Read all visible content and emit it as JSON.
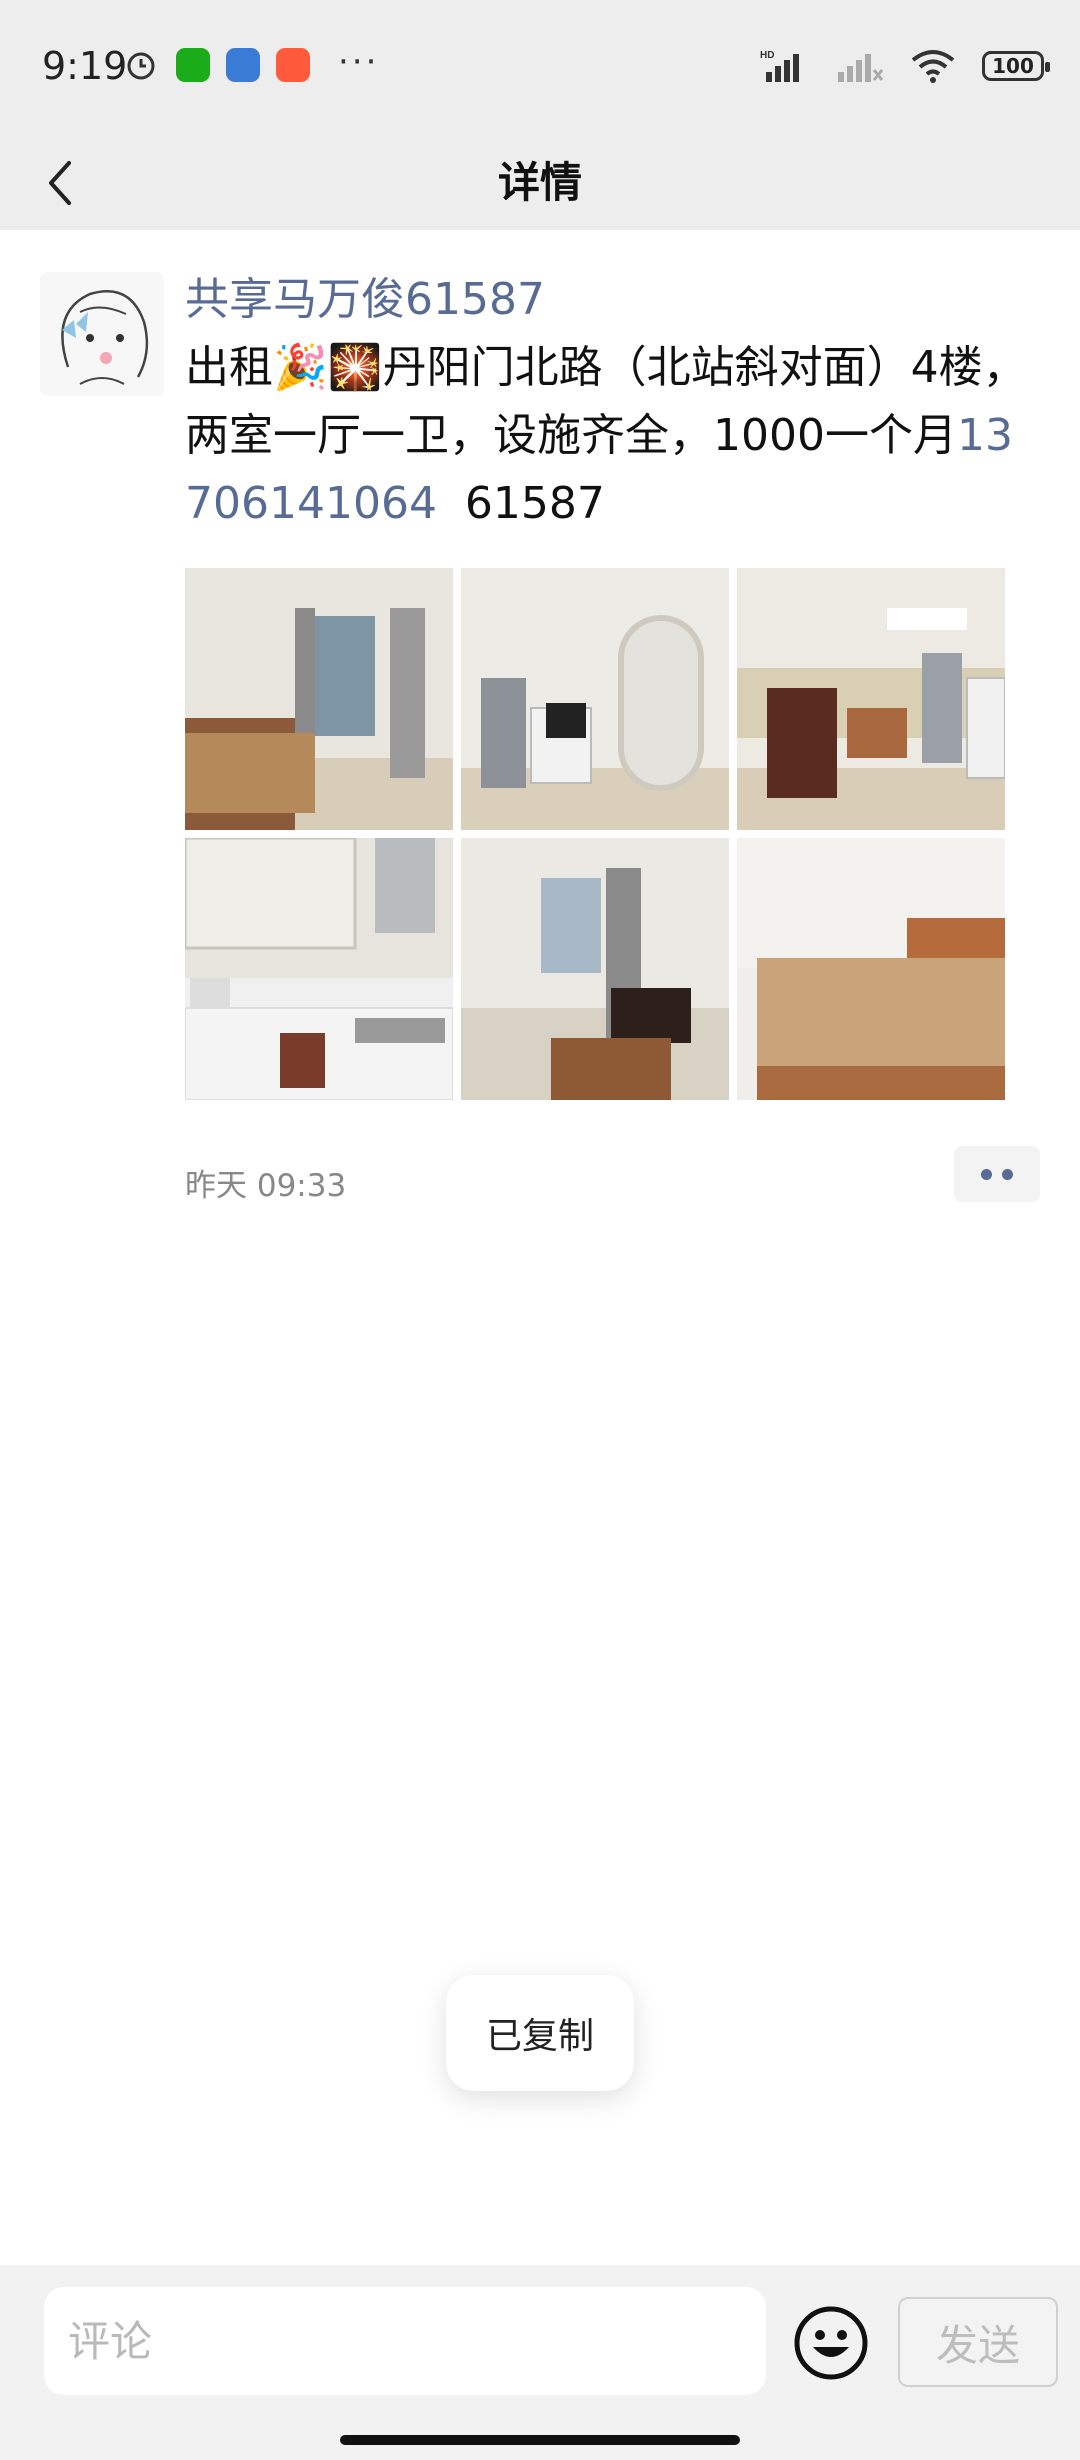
{
  "status": {
    "time": "9:19",
    "battery": "100",
    "network_label": "HD",
    "more": "···"
  },
  "nav": {
    "title": "详情"
  },
  "post": {
    "username": "共享马万俊61587",
    "text_part1": "出租🎉🎇丹阳门北路（北站斜对面）4楼，两室一厅一卫，设施齐全，1000一个月",
    "phone": "13706141064",
    "text_part2": "  61587",
    "timestamp": "昨天 09:33",
    "photos": [
      "bedroom-1",
      "living-room-arch",
      "living-dining",
      "kitchen",
      "room-sofa",
      "bedroom-2"
    ]
  },
  "toast": {
    "text": "已复制"
  },
  "composer": {
    "placeholder": "评论",
    "send_label": "发送"
  },
  "colors": {
    "link": "#576b95",
    "bar": "#ededed"
  }
}
